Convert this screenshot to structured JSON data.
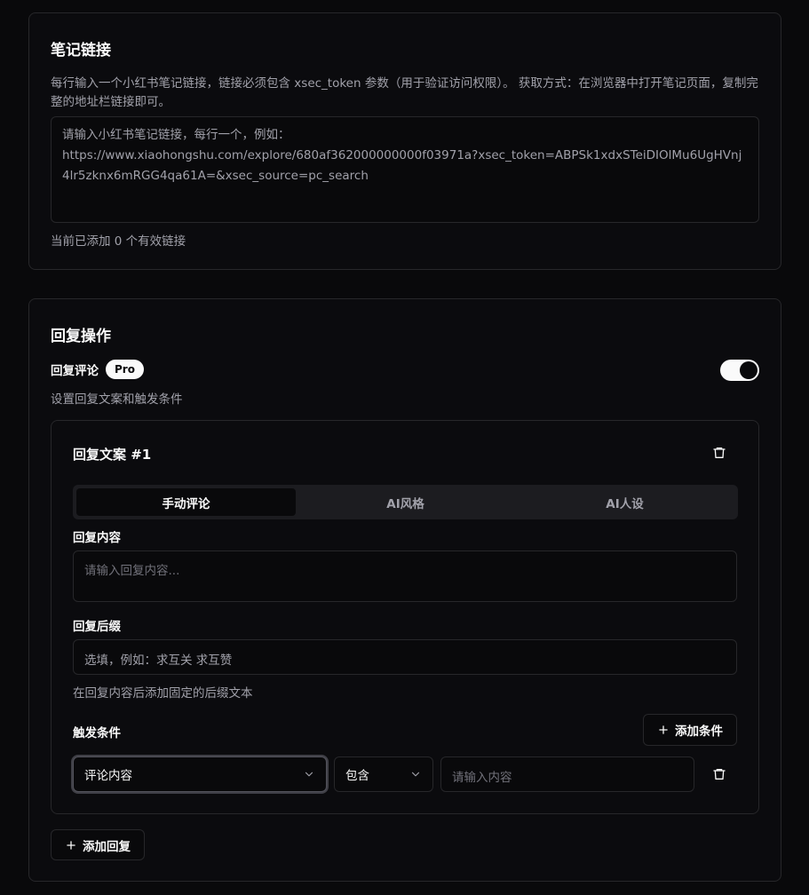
{
  "links_section": {
    "title": "笔记链接",
    "description": "每行输入一个小红书笔记链接，链接必须包含 xsec_token 参数（用于验证访问权限）。 获取方式：在浏览器中打开笔记页面，复制完整的地址栏链接即可。",
    "placeholder": "请输入小红书笔记链接，每行一个，例如：\nhttps://www.xiaohongshu.com/explore/680af362000000000f03971a?xsec_token=ABPSk1xdxSTeiDIOlMu6UgHVnj4lr5zknx6mRGG4qa61A=&xsec_source=pc_search",
    "count_text": "当前已添加 0 个有效链接"
  },
  "reply_section": {
    "title": "回复操作",
    "comment_label": "回复评论",
    "badge": "Pro",
    "comment_desc": "设置回复文案和触发条件",
    "toggle_on": true,
    "block": {
      "title": "回复文案 #1",
      "tabs": [
        {
          "label": "手动评论",
          "active": true
        },
        {
          "label": "AI风格",
          "active": false
        },
        {
          "label": "AI人设",
          "active": false
        }
      ],
      "content_label": "回复内容",
      "content_placeholder": "请输入回复内容...",
      "suffix_label": "回复后缀",
      "suffix_placeholder": "选填，例如：求互关 求互赞",
      "suffix_desc": "在回复内容后添加固定的后缀文本",
      "trigger_label": "触发条件",
      "add_condition_label": "添加条件",
      "condition": {
        "field": "评论内容",
        "operator": "包含",
        "value_placeholder": "请输入内容"
      }
    },
    "add_reply_label": "添加回复"
  },
  "colors": {
    "background": "#09090b",
    "border": "#27272a",
    "text": "#fafafa",
    "muted": "#a1a1aa"
  },
  "icons": [
    "trash-icon",
    "chevron-down-icon",
    "plus-icon"
  ]
}
